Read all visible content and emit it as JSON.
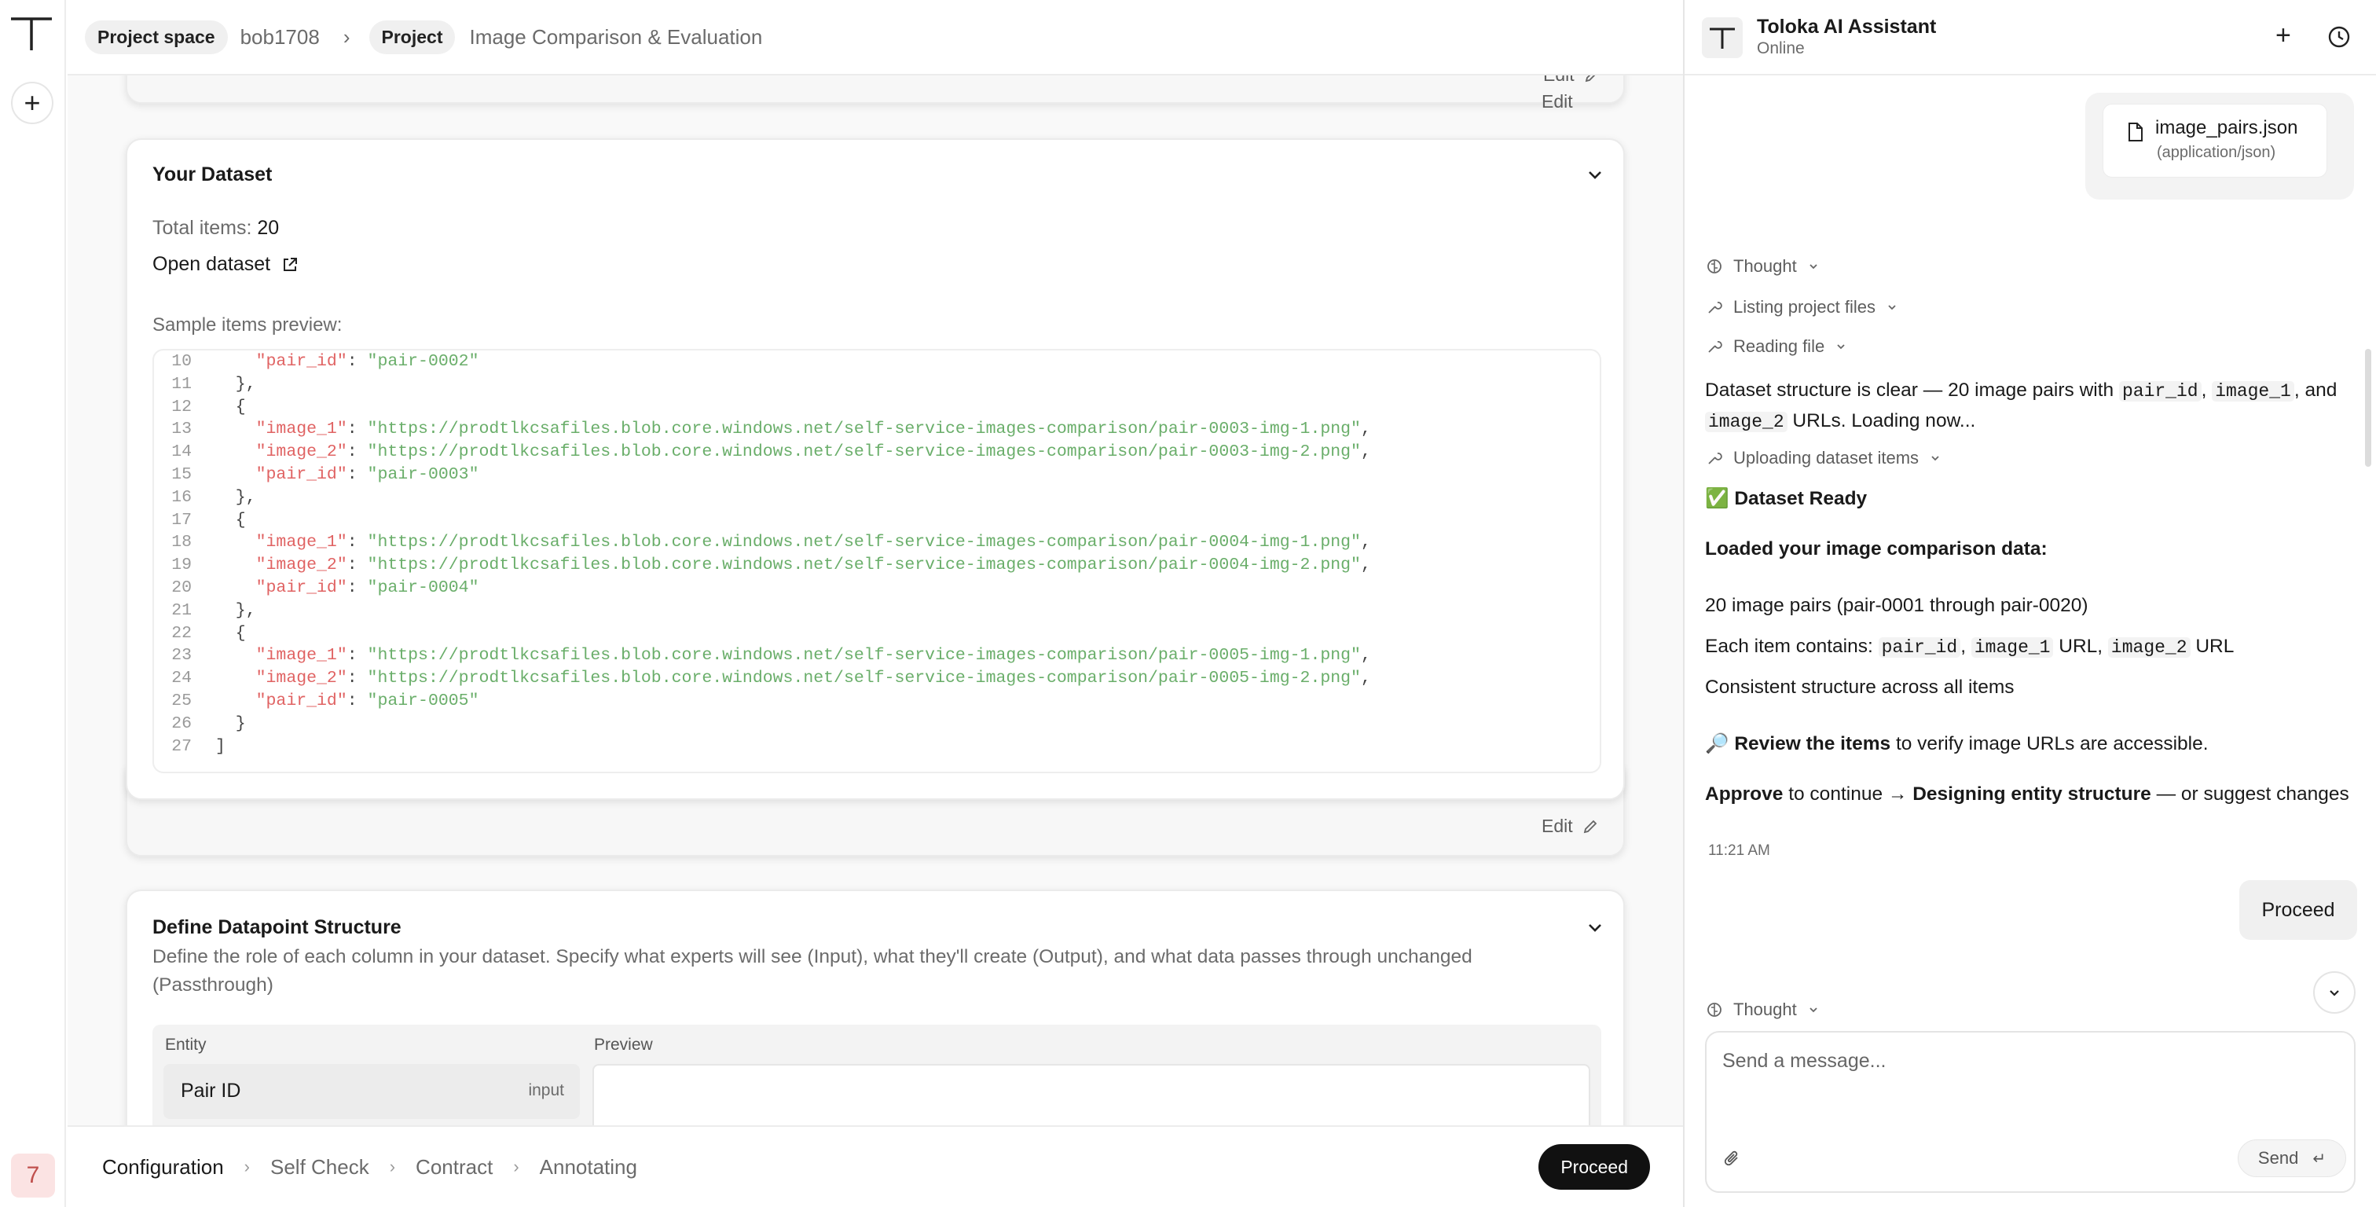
{
  "rail": {
    "avatar_label": "7"
  },
  "header": {
    "project_space_label": "Project space",
    "project_space_value": "bob1708",
    "project_label": "Project",
    "project_value": "Image Comparison & Evaluation"
  },
  "prev_card": {
    "edit_label": "Edit"
  },
  "dataset_card": {
    "title": "Your Dataset",
    "total_items_label": "Total items:",
    "total_items_value": "20",
    "open_dataset_label": "Open dataset",
    "sample_preview_label": "Sample items preview:",
    "edit_label": "Edit",
    "code_lines": [
      {
        "n": "10",
        "segments": [
          [
            "p",
            "    "
          ],
          [
            "k",
            "\"pair_id\""
          ],
          [
            "p",
            ": "
          ],
          [
            "s",
            "\"pair-0002\""
          ]
        ]
      },
      {
        "n": "11",
        "segments": [
          [
            "p",
            "  },"
          ]
        ]
      },
      {
        "n": "12",
        "segments": [
          [
            "p",
            "  {"
          ]
        ]
      },
      {
        "n": "13",
        "segments": [
          [
            "p",
            "    "
          ],
          [
            "k",
            "\"image_1\""
          ],
          [
            "p",
            ": "
          ],
          [
            "s",
            "\"https://prodtlkcsafiles.blob.core.windows.net/self-service-images-comparison/pair-0003-img-1.png\""
          ],
          [
            "p",
            ","
          ]
        ]
      },
      {
        "n": "14",
        "segments": [
          [
            "p",
            "    "
          ],
          [
            "k",
            "\"image_2\""
          ],
          [
            "p",
            ": "
          ],
          [
            "s",
            "\"https://prodtlkcsafiles.blob.core.windows.net/self-service-images-comparison/pair-0003-img-2.png\""
          ],
          [
            "p",
            ","
          ]
        ]
      },
      {
        "n": "15",
        "segments": [
          [
            "p",
            "    "
          ],
          [
            "k",
            "\"pair_id\""
          ],
          [
            "p",
            ": "
          ],
          [
            "s",
            "\"pair-0003\""
          ]
        ]
      },
      {
        "n": "16",
        "segments": [
          [
            "p",
            "  },"
          ]
        ]
      },
      {
        "n": "17",
        "segments": [
          [
            "p",
            "  {"
          ]
        ]
      },
      {
        "n": "18",
        "segments": [
          [
            "p",
            "    "
          ],
          [
            "k",
            "\"image_1\""
          ],
          [
            "p",
            ": "
          ],
          [
            "s",
            "\"https://prodtlkcsafiles.blob.core.windows.net/self-service-images-comparison/pair-0004-img-1.png\""
          ],
          [
            "p",
            ","
          ]
        ]
      },
      {
        "n": "19",
        "segments": [
          [
            "p",
            "    "
          ],
          [
            "k",
            "\"image_2\""
          ],
          [
            "p",
            ": "
          ],
          [
            "s",
            "\"https://prodtlkcsafiles.blob.core.windows.net/self-service-images-comparison/pair-0004-img-2.png\""
          ],
          [
            "p",
            ","
          ]
        ]
      },
      {
        "n": "20",
        "segments": [
          [
            "p",
            "    "
          ],
          [
            "k",
            "\"pair_id\""
          ],
          [
            "p",
            ": "
          ],
          [
            "s",
            "\"pair-0004\""
          ]
        ]
      },
      {
        "n": "21",
        "segments": [
          [
            "p",
            "  },"
          ]
        ]
      },
      {
        "n": "22",
        "segments": [
          [
            "p",
            "  {"
          ]
        ]
      },
      {
        "n": "23",
        "segments": [
          [
            "p",
            "    "
          ],
          [
            "k",
            "\"image_1\""
          ],
          [
            "p",
            ": "
          ],
          [
            "s",
            "\"https://prodtlkcsafiles.blob.core.windows.net/self-service-images-comparison/pair-0005-img-1.png\""
          ],
          [
            "p",
            ","
          ]
        ]
      },
      {
        "n": "24",
        "segments": [
          [
            "p",
            "    "
          ],
          [
            "k",
            "\"image_2\""
          ],
          [
            "p",
            ": "
          ],
          [
            "s",
            "\"https://prodtlkcsafiles.blob.core.windows.net/self-service-images-comparison/pair-0005-img-2.png\""
          ],
          [
            "p",
            ","
          ]
        ]
      },
      {
        "n": "25",
        "segments": [
          [
            "p",
            "    "
          ],
          [
            "k",
            "\"pair_id\""
          ],
          [
            "p",
            ": "
          ],
          [
            "s",
            "\"pair-0005\""
          ]
        ]
      },
      {
        "n": "26",
        "segments": [
          [
            "p",
            "  }"
          ]
        ]
      },
      {
        "n": "27",
        "segments": [
          [
            "p",
            "]"
          ]
        ]
      }
    ]
  },
  "structure_card": {
    "title": "Define Datapoint Structure",
    "description": "Define the role of each column in your dataset. Specify what experts will see (Input), what they'll create (Output), and what data passes through unchanged (Passthrough)",
    "col_entity": "Entity",
    "col_preview": "Preview",
    "row_entity": "Pair ID",
    "row_role": "input"
  },
  "bottom": {
    "steps": [
      "Configuration",
      "Self Check",
      "Contract",
      "Annotating"
    ],
    "proceed_label": "Proceed"
  },
  "assistant": {
    "title": "Toloka AI Assistant",
    "status": "Online",
    "file_name": "image_pairs.json",
    "file_type": "(application/json)",
    "tool_thought": "Thought",
    "tool_listing": "Listing project files",
    "tool_reading": "Reading file",
    "msg1_a": "Dataset structure is clear — 20 image pairs with ",
    "msg1_code1": "pair_id",
    "msg1_b": ", ",
    "msg1_code2": "image_1",
    "msg1_c": ", and ",
    "msg1_code3": "image_2",
    "msg1_d": " URLs. Loading now...",
    "tool_uploading": "Uploading dataset items",
    "ready_emoji": "✅",
    "ready_title": "Dataset Ready",
    "loaded_title": "Loaded your image comparison data:",
    "line_pairs": "20 image pairs (pair-0001 through pair-0020)",
    "line_each_a": "Each item contains: ",
    "line_each_code1": "pair_id",
    "line_each_b": ", ",
    "line_each_code2": "image_1",
    "line_each_c": " URL, ",
    "line_each_code3": "image_2",
    "line_each_d": " URL",
    "line_consistent": "Consistent structure across all items",
    "review_emoji": "🔎",
    "review_bold": "Review the items",
    "review_rest": " to verify image URLs are accessible.",
    "approve_bold": "Approve",
    "approve_mid": " to continue → ",
    "approve_bold2": "Designing entity structure",
    "approve_rest": " — or suggest changes",
    "timestamp": "11:21 AM",
    "user_msg": "Proceed",
    "tool_thought2": "Thought",
    "composer_placeholder": "Send a message...",
    "send_label": "Send"
  }
}
